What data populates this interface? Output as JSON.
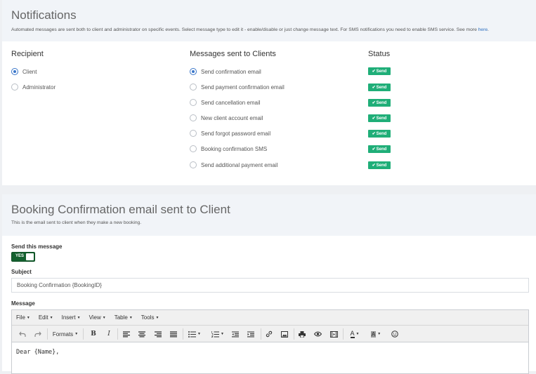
{
  "notifications": {
    "title": "Notifications",
    "description": "Automated messages are sent both to client and administrator on specific events. Select message type to edit it - enable/disable or just change message text. For SMS notifications you need to enable SMS service. See more ",
    "link_text": "here",
    "description_end": "."
  },
  "recipient": {
    "heading": "Recipient",
    "options": [
      {
        "label": "Client",
        "checked": true
      },
      {
        "label": "Administrator",
        "checked": false
      }
    ]
  },
  "messages": {
    "heading": "Messages sent to Clients",
    "items": [
      {
        "label": "Send confirmation email",
        "checked": true
      },
      {
        "label": "Send payment confirmation email",
        "checked": false
      },
      {
        "label": "Send cancellation email",
        "checked": false
      },
      {
        "label": "New client account email",
        "checked": false
      },
      {
        "label": "Send forgot password email",
        "checked": false
      },
      {
        "label": "Booking confirmation SMS",
        "checked": false
      },
      {
        "label": "Send additional payment email",
        "checked": false
      }
    ]
  },
  "status": {
    "heading": "Status",
    "badge_label": "Send",
    "badge_color": "#1fae78"
  },
  "booking_email": {
    "title": "Booking Confirmation email sent to Client",
    "description": "This is the email sent to client when they make a new booking.",
    "send_label": "Send this message",
    "toggle_label": "YES",
    "subject_label": "Subject",
    "subject_value": "Booking Confirmation {BookingID}",
    "message_label": "Message"
  },
  "editor": {
    "menus": [
      "File",
      "Edit",
      "Insert",
      "View",
      "Table",
      "Tools"
    ],
    "formats_label": "Formats",
    "content": "Dear {Name},",
    "icons": [
      "undo-icon",
      "redo-icon",
      "bold-icon",
      "italic-icon",
      "align-left-icon",
      "align-center-icon",
      "align-right-icon",
      "align-justify-icon",
      "bullet-list-icon",
      "numbered-list-icon",
      "outdent-icon",
      "indent-icon",
      "link-icon",
      "image-icon",
      "print-icon",
      "preview-icon",
      "media-icon",
      "text-color-icon",
      "background-color-icon",
      "emoticons-icon"
    ]
  },
  "colors": {
    "accent": "#3a76c9",
    "toggle": "#14612f",
    "header_bg": "#f1f4f8"
  }
}
